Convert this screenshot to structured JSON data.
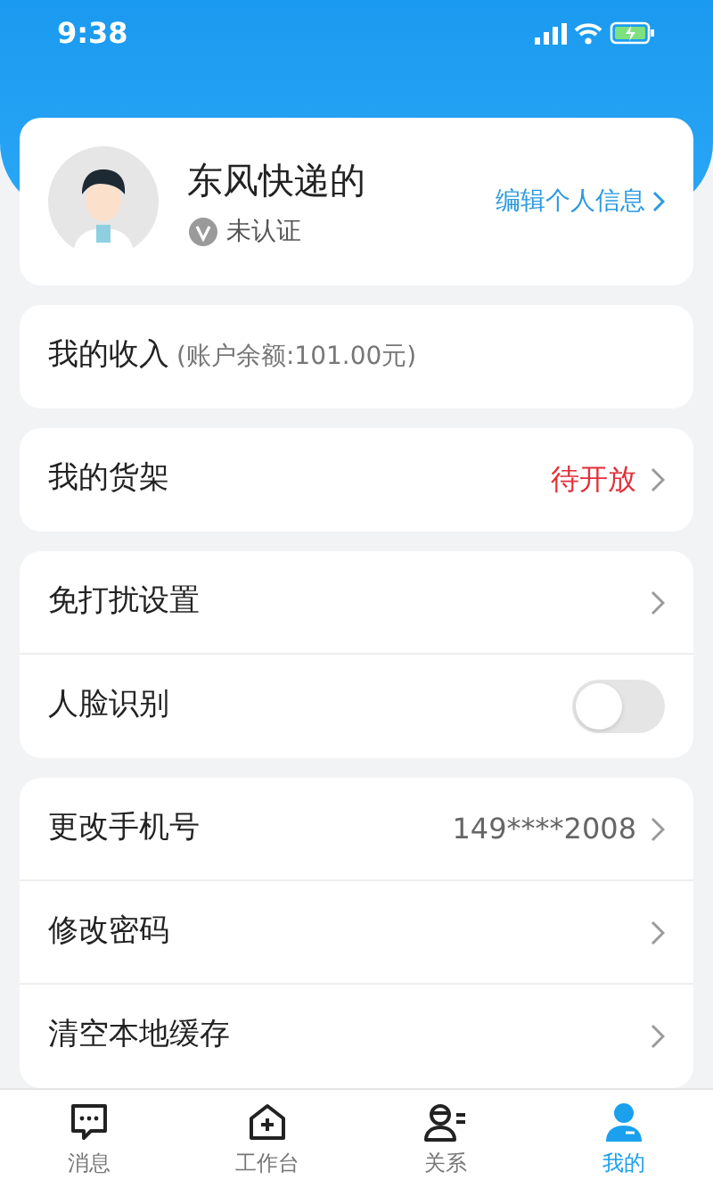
{
  "status_bar": {
    "time": "9:38"
  },
  "profile": {
    "name": "东风快递的",
    "verification": "未认证",
    "edit_link": "编辑个人信息"
  },
  "sections": [
    {
      "items": [
        {
          "kind": "income",
          "label": "我的收入",
          "note": "(账户余额:101.00元)"
        }
      ]
    },
    {
      "items": [
        {
          "kind": "link",
          "label": "我的货架",
          "value": "待开放",
          "highlighted": true
        }
      ]
    },
    {
      "items": [
        {
          "kind": "link",
          "label": "免打扰设置"
        },
        {
          "kind": "toggle",
          "label": "人脸识别",
          "on": false
        }
      ]
    },
    {
      "items": [
        {
          "kind": "link",
          "label": "更改手机号",
          "value": "149****2008"
        },
        {
          "kind": "link",
          "label": "修改密码"
        },
        {
          "kind": "link",
          "label": "清空本地缓存"
        }
      ]
    }
  ],
  "tab_bar": [
    {
      "label": "消息",
      "selected": false
    },
    {
      "label": "工作台",
      "selected": false
    },
    {
      "label": "关系",
      "selected": false
    },
    {
      "label": "我的",
      "selected": true
    }
  ]
}
